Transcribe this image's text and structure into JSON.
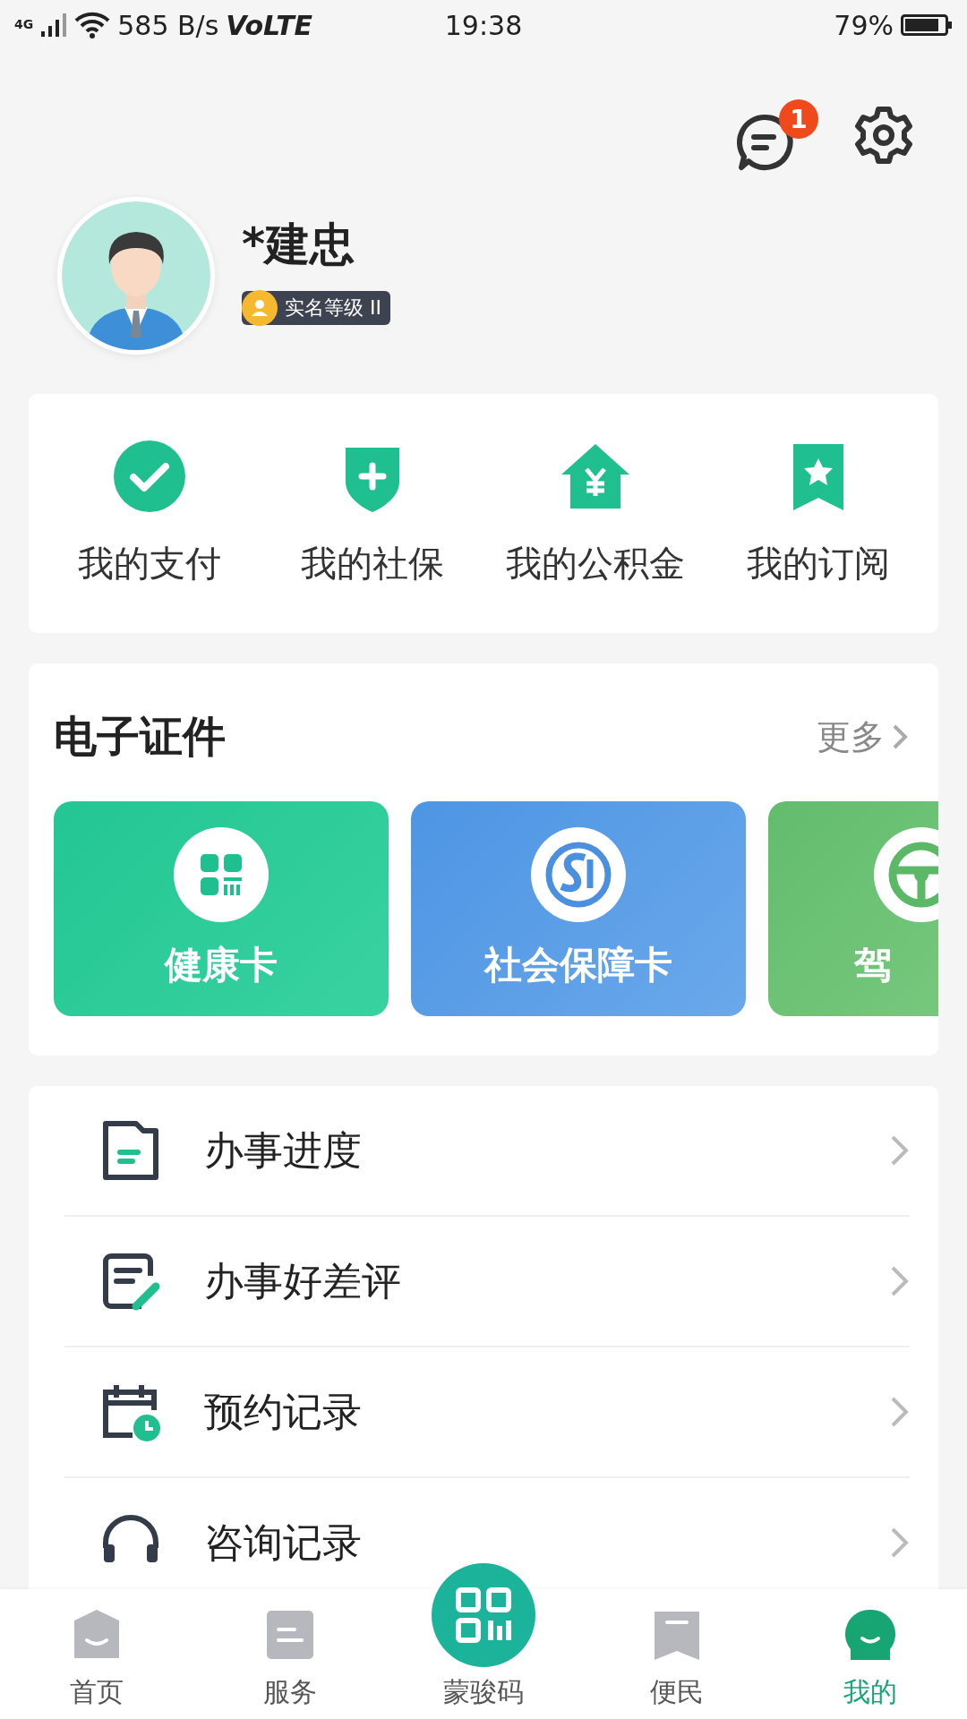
{
  "status_bar": {
    "network": "4G",
    "speed": "585 B/s",
    "volte": "VoLTE",
    "time": "19:38",
    "battery": "79%"
  },
  "header": {
    "message_badge": "1"
  },
  "profile": {
    "name": "*建忠",
    "badge": "实名等级 II"
  },
  "shortcuts": [
    {
      "label": "我的支付",
      "kind": "check"
    },
    {
      "label": "我的社保",
      "kind": "shield"
    },
    {
      "label": "我的公积金",
      "kind": "house"
    },
    {
      "label": "我的订阅",
      "kind": "bookmark"
    }
  ],
  "certificates": {
    "title": "电子证件",
    "more": "更多",
    "cards": [
      {
        "label": "健康卡",
        "kind": "health"
      },
      {
        "label": "社会保障卡",
        "kind": "social"
      },
      {
        "label": "驾",
        "kind": "driving"
      }
    ]
  },
  "menu": [
    {
      "label": "办事进度",
      "kind": "progress"
    },
    {
      "label": "办事好差评",
      "kind": "review"
    },
    {
      "label": "预约记录",
      "kind": "appointment"
    },
    {
      "label": "咨询记录",
      "kind": "consult"
    }
  ],
  "tabs": [
    {
      "label": "首页",
      "kind": "home",
      "selected": false
    },
    {
      "label": "服务",
      "kind": "service",
      "selected": false
    },
    {
      "label": "蒙骏码",
      "kind": "code",
      "selected": false
    },
    {
      "label": "便民",
      "kind": "convenience",
      "selected": false
    },
    {
      "label": "我的",
      "kind": "mine",
      "selected": true
    }
  ]
}
